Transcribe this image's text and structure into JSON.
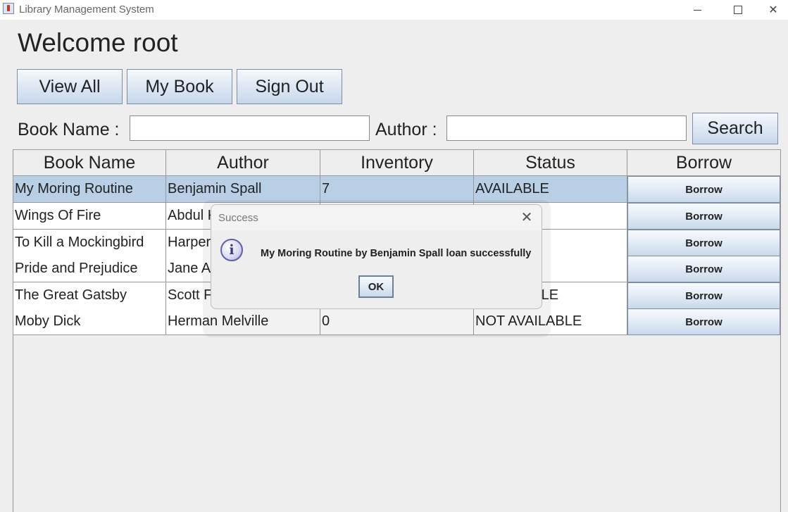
{
  "window": {
    "title": "Library Management System"
  },
  "header": {
    "welcome": "Welcome root",
    "view_all_label": "View All",
    "my_book_label": "My Book",
    "sign_out_label": "Sign Out"
  },
  "search": {
    "book_name_label": "Book Name :",
    "book_name_value": "",
    "author_label": "Author :",
    "author_value": "",
    "search_label": "Search"
  },
  "table": {
    "columns": [
      "Book Name",
      "Author",
      "Inventory",
      "Status",
      "Borrow"
    ],
    "rows": [
      {
        "book": "My Moring Routine",
        "author": "Benjamin Spall",
        "inventory": "7",
        "status": "AVAILABLE",
        "action": "Borrow",
        "selected": true
      },
      {
        "book": "Wings Of Fire",
        "author": "Abdul K",
        "inventory": "",
        "status": "E",
        "action": "Borrow"
      },
      {
        "book": "To Kill a Mockingbird",
        "author": "Harper",
        "inventory": "",
        "status": "E",
        "action": "Borrow"
      },
      {
        "book": "Pride and Prejudice",
        "author": "Jane A",
        "inventory": "",
        "status": "E",
        "action": "Borrow"
      },
      {
        "book": "The Great Gatsby",
        "author": "Scott F",
        "inventory": "",
        "status": "ABLE",
        "action": "Borrow"
      },
      {
        "book": "Moby Dick",
        "author": "Herman Melville",
        "inventory": "0",
        "status": "NOT AVAILABLE",
        "action": "Borrow"
      }
    ]
  },
  "dialog": {
    "title": "Success",
    "message": "My Moring Routine by Benjamin Spall loan successfully",
    "ok_label": "OK",
    "icon": "info-icon"
  },
  "colors": {
    "selected_row": "#b8cfe5",
    "background": "#eeeeee"
  }
}
